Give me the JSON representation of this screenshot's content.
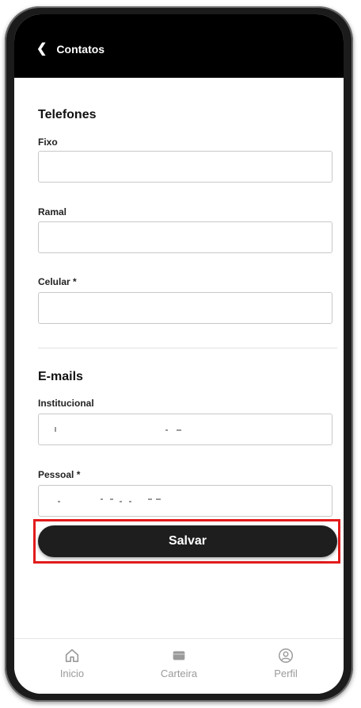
{
  "header": {
    "back_label": "Contatos"
  },
  "phones": {
    "title": "Telefones",
    "fixo": {
      "label": "Fixo",
      "value": ""
    },
    "ramal": {
      "label": "Ramal",
      "value": ""
    },
    "celular": {
      "label": "Celular *",
      "value": ""
    }
  },
  "emails": {
    "title": "E-mails",
    "institucional": {
      "label": "Institucional"
    },
    "pessoal": {
      "label": "Pessoal *"
    }
  },
  "actions": {
    "save_label": "Salvar",
    "highlight_color": "#e21b1b"
  },
  "bottom_nav": {
    "items": [
      {
        "label": "Inicio",
        "icon": "home-icon"
      },
      {
        "label": "Carteira",
        "icon": "wallet-icon"
      },
      {
        "label": "Perfil",
        "icon": "user-icon"
      }
    ]
  }
}
